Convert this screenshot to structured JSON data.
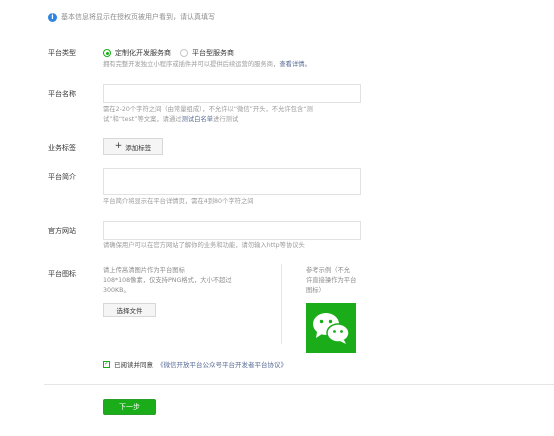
{
  "notice": {
    "text": "基本信息将显示在授权页被用户看到，请认真填写"
  },
  "platform_type": {
    "label": "平台类型",
    "options": [
      {
        "label": "定制化开发服务商",
        "selected": true
      },
      {
        "label": "平台型服务商",
        "selected": false
      }
    ],
    "hint": "拥有完整开发独立小程序或插件并可以提供后续运营的服务商，",
    "hint_link": "查看详情。"
  },
  "platform_name": {
    "label": "平台名称",
    "value": "",
    "hint_line1": "需在2-20个字符之间（由常量组成），不允许以“微信”开头，不允许包含“测",
    "hint_line2_prefix": "试”和“test”等文案，请通过",
    "hint_line2_link": "测试白名单",
    "hint_line2_suffix": "进行测试"
  },
  "business_tags": {
    "label": "业务标签",
    "add_button": "添加标签"
  },
  "platform_intro": {
    "label": "平台简介",
    "value": "",
    "hint": "平台简介将显示在平台详情页，需在4到80个字符之间"
  },
  "official_site": {
    "label": "官方网站",
    "value": "",
    "hint": "请确保用户可以在官方网站了解你的业务和功能，请勿输入http等协议头"
  },
  "platform_icon": {
    "label": "平台图标",
    "desc_line1": "请上传高清图片作为平台图标",
    "desc_line2": "108*108像素，仅支持PNG格式，大小不超过",
    "desc_line3": "300KB。",
    "choose_file": "选择文件",
    "example_line1": "参考示例（不允",
    "example_line2": "许直接操作为平台",
    "example_line3": "图标）"
  },
  "agreement": {
    "checked": true,
    "prefix": "已阅读并同意",
    "link": "《微信开放平台公众号平台开发者平台协议》"
  },
  "next_button": "下一步",
  "colors": {
    "brand_green": "#1aad19",
    "link_blue": "#576b95",
    "info_blue": "#2f86de"
  }
}
